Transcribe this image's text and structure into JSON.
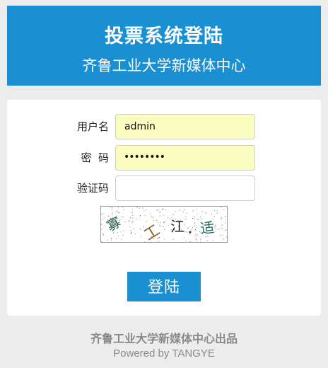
{
  "header": {
    "title": "投票系统登陆",
    "subtitle": "齐鲁工业大学新媒体中心"
  },
  "form": {
    "username": {
      "label": "用户名",
      "value": "admin"
    },
    "password": {
      "label": "密  码",
      "value": "••••••••"
    },
    "captcha_input": {
      "label": "验证码",
      "value": ""
    },
    "captcha_image": {
      "chars": [
        "寡",
        "工",
        "江",
        "适"
      ]
    },
    "submit_label": "登陆"
  },
  "footer": {
    "line1": "齐鲁工业大学新媒体中心出品",
    "line2": "Powered by TANGYE"
  },
  "colors": {
    "accent": "#1a8fd1",
    "autofill": "#fafcc0",
    "background": "#ececec"
  }
}
